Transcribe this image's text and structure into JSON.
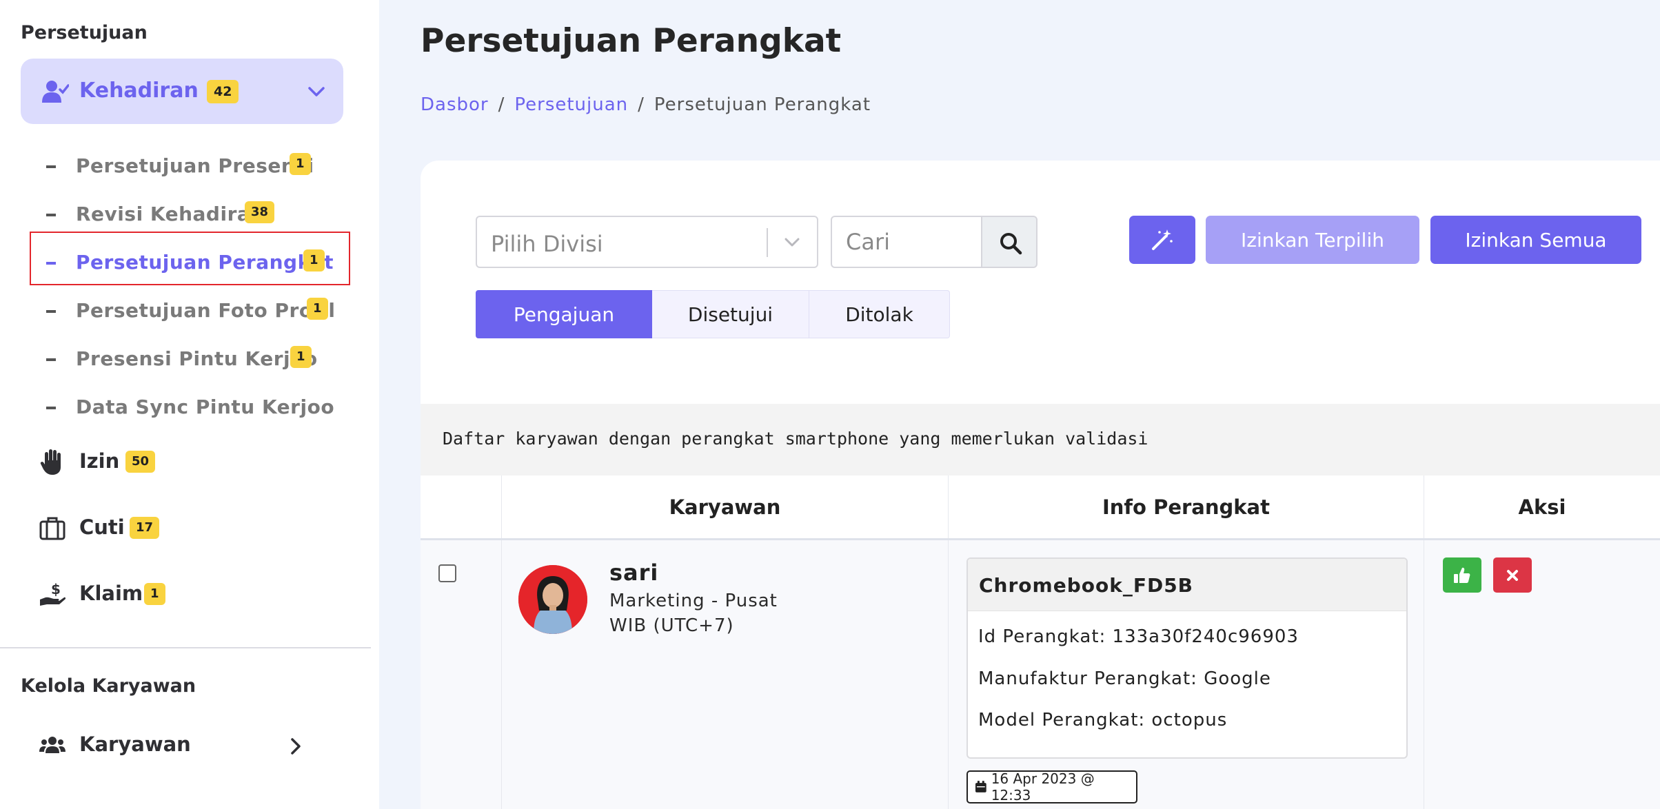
{
  "sidebar": {
    "section_approval": "Persetujuan",
    "attendance": {
      "label": "Kehadiran",
      "badge": "42"
    },
    "sub_items": [
      {
        "label": "Persetujuan Presensi",
        "badge": "1"
      },
      {
        "label": "Revisi Kehadiran",
        "badge": "38"
      },
      {
        "label": "Persetujuan Perangkat",
        "badge": "1"
      },
      {
        "label": "Persetujuan Foto Profil",
        "badge": "1"
      },
      {
        "label": "Presensi Pintu Kerjoo",
        "badge": "1"
      },
      {
        "label": "Data Sync Pintu Kerjoo",
        "badge": ""
      }
    ],
    "main_items": [
      {
        "label": "Izin",
        "badge": "50",
        "icon": "hand-icon"
      },
      {
        "label": "Cuti",
        "badge": "17",
        "icon": "briefcase-icon"
      },
      {
        "label": "Klaim",
        "badge": "1",
        "icon": "hand-dollar-icon"
      }
    ],
    "section_employees": "Kelola Karyawan",
    "employees_item": {
      "label": "Karyawan",
      "icon": "users-icon"
    }
  },
  "page": {
    "title": "Persetujuan Perangkat",
    "breadcrumb": [
      "Dasbor",
      "Persetujuan",
      "Persetujuan Perangkat"
    ],
    "breadcrumb_sep": "/"
  },
  "filters": {
    "division_placeholder": "Pilih Divisi",
    "search_placeholder": "Cari"
  },
  "actions": {
    "approve_selected": "Izinkan Terpilih",
    "approve_all": "Izinkan Semua"
  },
  "tabs": [
    "Pengajuan",
    "Disetujui",
    "Ditolak"
  ],
  "active_tab": "Pengajuan",
  "info_text": "Daftar karyawan dengan perangkat smartphone yang memerlukan validasi",
  "table": {
    "headers": [
      "",
      "Karyawan",
      "Info Perangkat",
      "Aksi"
    ],
    "rows": [
      {
        "employee": {
          "name": "sari",
          "division": "Marketing - Pusat",
          "timezone": "WIB (UTC+7)"
        },
        "device": {
          "name": "Chromebook_FD5B",
          "id_line": "Id Perangkat: 133a30f240c96903",
          "manufacturer_line": "Manufaktur Perangkat: Google",
          "model_line": "Model Perangkat: octopus",
          "date": "16 Apr 2023 @ 12:33"
        }
      }
    ]
  },
  "colors": {
    "accent": "#6c63ee",
    "accent_light": "#a6a0f6",
    "badge": "#f9d33f",
    "approve": "#3cb347",
    "reject": "#dc3545",
    "highlight_outline": "#e3262c"
  }
}
